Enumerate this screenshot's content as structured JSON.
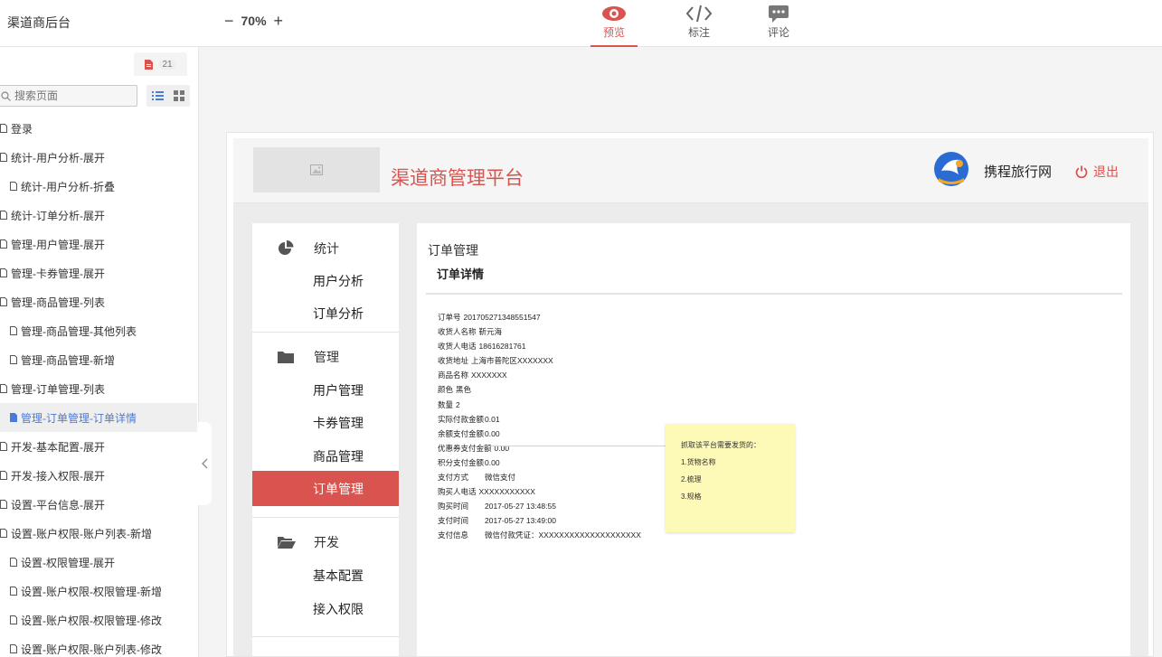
{
  "app_title": "渠道商后台",
  "zoom": {
    "minus": "−",
    "value": "70%",
    "plus": "+"
  },
  "tabs": [
    {
      "label": "预览",
      "icon": "eye-icon",
      "active": true
    },
    {
      "label": "标注",
      "icon": "code-icon",
      "active": false
    },
    {
      "label": "评论",
      "icon": "comment-icon",
      "active": false
    }
  ],
  "sidebar": {
    "page_count": "21",
    "search_placeholder": "搜索页面",
    "pages": [
      {
        "label": "登录",
        "indent": 0
      },
      {
        "label": "统计-用户分析-展开",
        "indent": 0
      },
      {
        "label": "统计-用户分析-折叠",
        "indent": 1
      },
      {
        "label": "统计-订单分析-展开",
        "indent": 0
      },
      {
        "label": "管理-用户管理-展开",
        "indent": 0
      },
      {
        "label": "管理-卡券管理-展开",
        "indent": 0
      },
      {
        "label": "管理-商品管理-列表",
        "indent": 0
      },
      {
        "label": "管理-商品管理-其他列表",
        "indent": 1
      },
      {
        "label": "管理-商品管理-新增",
        "indent": 1
      },
      {
        "label": "管理-订单管理-列表",
        "indent": 0
      },
      {
        "label": "管理-订单管理-订单详情",
        "indent": 1,
        "active": true
      },
      {
        "label": "开发-基本配置-展开",
        "indent": 0
      },
      {
        "label": "开发-接入权限-展开",
        "indent": 0
      },
      {
        "label": "设置-平台信息-展开",
        "indent": 0
      },
      {
        "label": "设置-账户权限-账户列表-新增",
        "indent": 0
      },
      {
        "label": "设置-权限管理-展开",
        "indent": 1
      },
      {
        "label": "设置-账户权限-权限管理-新增",
        "indent": 1
      },
      {
        "label": "设置-账户权限-权限管理-修改",
        "indent": 1
      },
      {
        "label": "设置-账户权限-账户列表-修改",
        "indent": 1
      }
    ]
  },
  "proto": {
    "platform_title": "渠道商管理平台",
    "brand_name": "携程旅行网",
    "logout_label": "退出",
    "nav": {
      "stats": {
        "label": "统计",
        "items": [
          "用户分析",
          "订单分析"
        ]
      },
      "manage": {
        "label": "管理",
        "items": [
          "用户管理",
          "卡券管理",
          "商品管理",
          "订单管理"
        ]
      },
      "dev": {
        "label": "开发",
        "items": [
          "基本配置",
          "接入权限"
        ]
      }
    },
    "breadcrumb": "订单管理",
    "detail_title": "订单详情",
    "fields": [
      {
        "k": "订单号",
        "v": "201705271348551547"
      },
      {
        "k": "收货人名称",
        "v": "靳元海"
      },
      {
        "k": "收货人电话",
        "v": "18616281761"
      },
      {
        "k": "收货地址",
        "v": "上海市普陀区XXXXXXX"
      },
      {
        "k": "商品名称",
        "v": "XXXXXXX"
      },
      {
        "k": "颜色",
        "v": "黑色"
      },
      {
        "k": "数量",
        "v": "2"
      },
      {
        "k": "实际付款金额",
        "v": "0.01"
      },
      {
        "k": "余额支付金额",
        "v": "0.00"
      },
      {
        "k": "优惠券支付金额",
        "v": "0.00"
      },
      {
        "k": "积分支付金额",
        "v": "0.00"
      },
      {
        "k": "支付方式",
        "v": "微信支付"
      },
      {
        "k": "购买人电话",
        "v": "XXXXXXXXXXX"
      },
      {
        "k": "购买时间",
        "v": "2017-05-27 13:48:55"
      },
      {
        "k": "支付时间",
        "v": "2017-05-27 13:49:00"
      },
      {
        "k": "支付信息",
        "v": "微信付款凭证：XXXXXXXXXXXXXXXXXXXX"
      }
    ],
    "note": {
      "title": "抓取该平台需要发货的：",
      "lines": [
        "1.货物名称",
        "2.梳理",
        "3.规格"
      ]
    }
  },
  "colors": {
    "accent": "#d9534f",
    "active_link": "#4a7bd6",
    "note_bg": "#fdf9b7"
  }
}
